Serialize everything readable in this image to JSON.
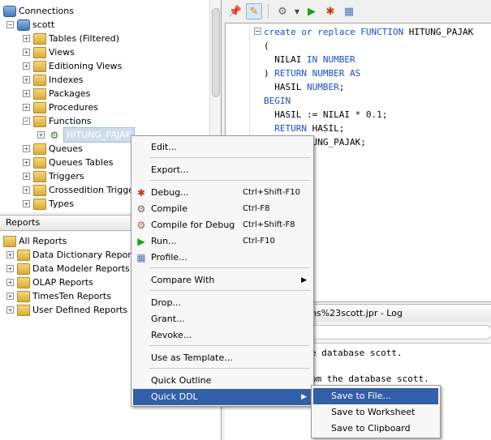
{
  "connections": {
    "title": "Connections",
    "db": "scott",
    "nodes": [
      {
        "label": "Tables (Filtered)"
      },
      {
        "label": "Views"
      },
      {
        "label": "Editioning Views"
      },
      {
        "label": "Indexes"
      },
      {
        "label": "Packages"
      },
      {
        "label": "Procedures"
      },
      {
        "label": "Functions"
      },
      {
        "label": "HITUNG_PAJAK"
      },
      {
        "label": "Queues"
      },
      {
        "label": "Queues Tables"
      },
      {
        "label": "Triggers"
      },
      {
        "label": "Crossedition Triggers"
      },
      {
        "label": "Types"
      }
    ]
  },
  "reports": {
    "header": "Reports",
    "root": "All Reports",
    "items": [
      "Data Dictionary Reports",
      "Data Modeler Reports",
      "OLAP Reports",
      "TimesTen Reports",
      "User Defined Reports"
    ]
  },
  "editor": {
    "line1_kw": "create or replace FUNCTION",
    "line1_name": " HITUNG_PAJAK",
    "line2": "(",
    "line3_a": "  NILAI ",
    "line3_kw": "IN NUMBER",
    "line4_a": ") ",
    "line4_kw": "RETURN NUMBER AS",
    "line5_a": "  HASIL ",
    "line5_kw": "NUMBER",
    "line5_b": ";",
    "line6": "BEGIN",
    "line7_a": "  HASIL := NILAI * ",
    "line7_num": "0.1",
    "line7_b": ";",
    "line8_kw": "  RETURN",
    "line8_b": " HASIL;",
    "line9": "  END HITUNG_PAJAK;"
  },
  "log": {
    "title": "ns%23scott.jpr - Log",
    "line1": "e database scott.",
    "line2": "om the database scott."
  },
  "context_menu": {
    "edit": "Edit...",
    "export": "Export...",
    "debug": "Debug...",
    "debug_short": "Ctrl+Shift-F10",
    "compile": "Compile",
    "compile_short": "Ctrl-F8",
    "compile_debug": "Compile for Debug",
    "compile_debug_short": "Ctrl+Shift-F8",
    "run": "Run...",
    "run_short": "Ctrl-F10",
    "profile": "Profile...",
    "compare_with": "Compare With",
    "drop": "Drop...",
    "grant": "Grant...",
    "revoke": "Revoke...",
    "use_as_template": "Use as Template...",
    "quick_outline": "Quick Outline",
    "quick_ddl": "Quick DDL"
  },
  "submenu": {
    "save_to_file": "Save to File...",
    "save_to_worksheet": "Save to Worksheet",
    "save_to_clipboard": "Save to Clipboard"
  },
  "colors": {
    "accent": "#335ea8",
    "keyword": "#1a4ec7",
    "selection": "#3399ff"
  }
}
